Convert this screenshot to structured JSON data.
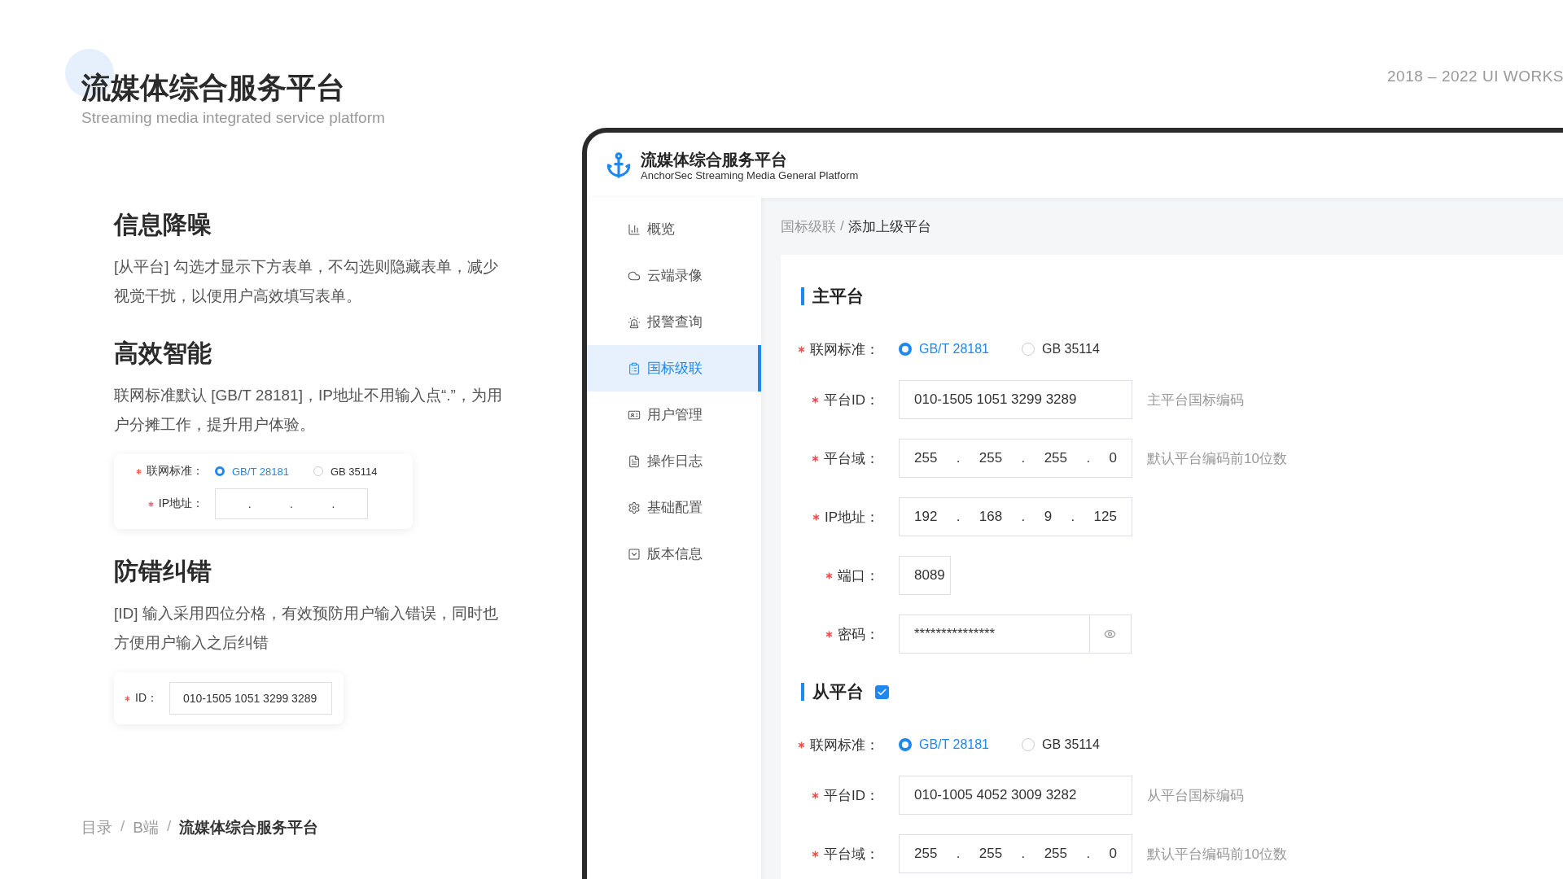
{
  "header": {
    "title": "流媒体综合服务平台",
    "subtitle": "Streaming media integrated service platform",
    "years": "2018 – 2022 UI WORKS"
  },
  "features": [
    {
      "heading": "信息降噪",
      "text": "[从平台] 勾选才显示下方表单，不勾选则隐藏表单，减少视觉干扰，以便用户高效填写表单。"
    },
    {
      "heading": "高效智能",
      "text": "联网标准默认 [GB/T 28181]，IP地址不用输入点“.”，为用户分摊工作，提升用户体验。",
      "demo": [
        {
          "kind": "radio",
          "label": "联网标准：",
          "required": true,
          "options": [
            {
              "label": "GB/T 28181",
              "selected": true
            },
            {
              "label": "GB 35114",
              "selected": false
            }
          ]
        },
        {
          "kind": "segments",
          "label": "IP地址：",
          "required": true,
          "separator": "."
        }
      ]
    },
    {
      "heading": "防错纠错",
      "text": "[ID] 输入采用四位分格，有效预防用户输入错误，同时也方便用户输入之后纠错",
      "demo": [
        {
          "kind": "text",
          "label": "ID：",
          "required": true,
          "value": "010-1505 1051 3299 3289"
        }
      ]
    }
  ],
  "breadcrumb": [
    {
      "label": "目录",
      "current": false
    },
    {
      "label": "B端",
      "current": false
    },
    {
      "label": "流媒体综合服务平台",
      "current": true
    }
  ],
  "breadcrumb_separator": "/",
  "app": {
    "brand_title": "流媒体综合服务平台",
    "brand_subtitle": "AnchorSec Streaming Media General Platform",
    "nav": [
      {
        "label": "概览",
        "selected": false
      },
      {
        "label": "云端录像",
        "selected": false
      },
      {
        "label": "报警查询",
        "selected": false
      },
      {
        "label": "国标级联",
        "selected": true
      },
      {
        "label": "用户管理",
        "selected": false
      },
      {
        "label": "操作日志",
        "selected": false
      },
      {
        "label": "基础配置",
        "selected": false
      },
      {
        "label": "版本信息",
        "selected": false
      }
    ],
    "breadcrumb": [
      "国标级联",
      "添加上级平台"
    ],
    "breadcrumb_separator": "/",
    "sections": [
      {
        "title": "主平台",
        "rows": [
          {
            "kind": "radio",
            "label": "联网标准：",
            "required": true,
            "options": [
              {
                "label": "GB/T 28181",
                "selected": true
              },
              {
                "label": "GB 35114",
                "selected": false
              }
            ]
          },
          {
            "kind": "text",
            "label": "平台ID：",
            "required": true,
            "value": "010-1505 1051 3299 3289",
            "hint": "主平台国标编码"
          },
          {
            "kind": "segments",
            "label": "平台域：",
            "required": true,
            "separator": ".",
            "values": [
              "255",
              "255",
              "255",
              "0"
            ],
            "hint": "默认平台编码前10位数"
          },
          {
            "kind": "segments",
            "label": "IP地址：",
            "required": true,
            "separator": ".",
            "values": [
              "192",
              "168",
              "9",
              "125"
            ]
          },
          {
            "kind": "short",
            "label": "端口：",
            "required": true,
            "value": "8089"
          },
          {
            "kind": "password",
            "label": "密码：",
            "required": true,
            "value": "***************"
          }
        ]
      },
      {
        "title": "从平台",
        "checkbox": {
          "checked": true
        },
        "rows": [
          {
            "kind": "radio",
            "label": "联网标准：",
            "required": true,
            "options": [
              {
                "label": "GB/T 28181",
                "selected": true
              },
              {
                "label": "GB 35114",
                "selected": false
              }
            ]
          },
          {
            "kind": "text",
            "label": "平台ID：",
            "required": true,
            "value": "010-1005 4052 3009 3282",
            "hint": "从平台国标编码"
          },
          {
            "kind": "segments",
            "label": "平台域：",
            "required": true,
            "separator": ".",
            "values": [
              "255",
              "255",
              "255",
              "0"
            ],
            "hint": "默认平台编码前10位数"
          }
        ]
      }
    ]
  }
}
